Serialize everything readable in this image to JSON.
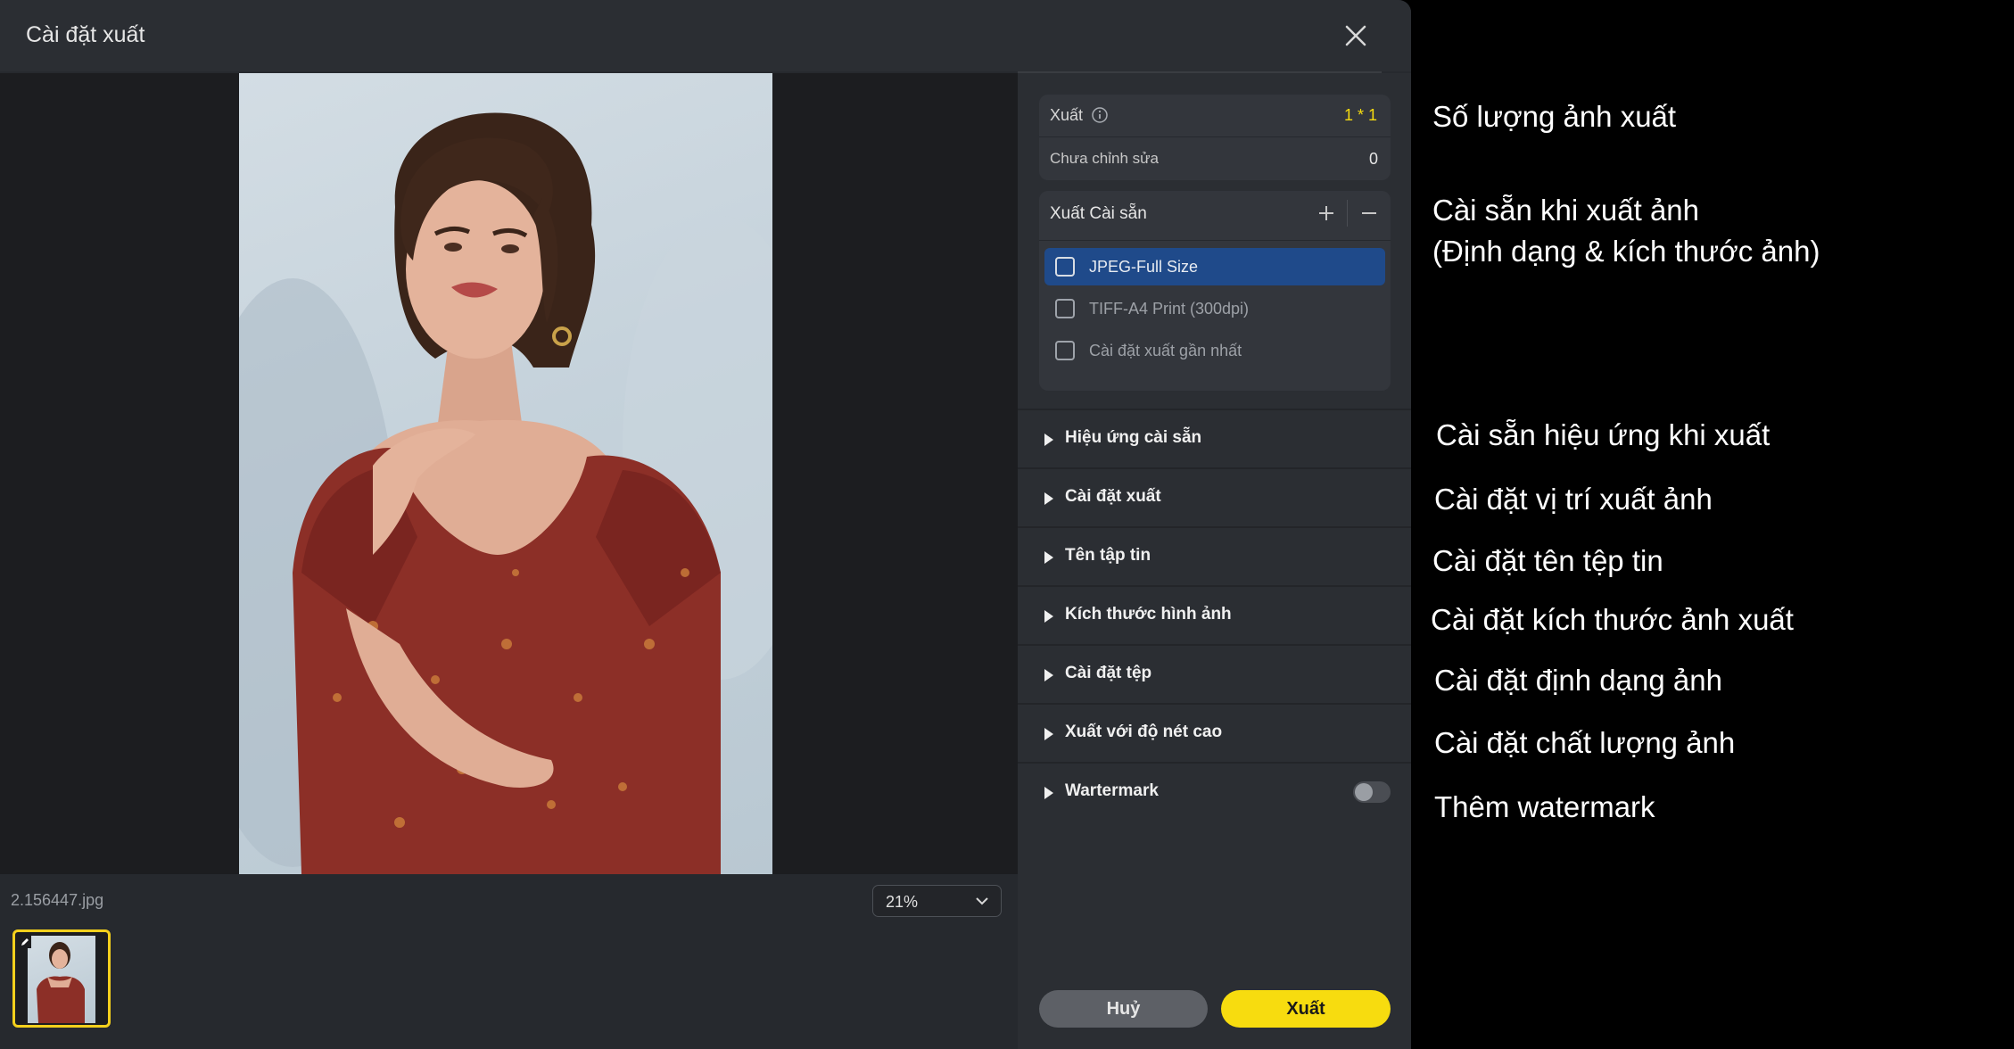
{
  "dialog": {
    "title": "Cài đặt xuất",
    "close_icon": "close-icon"
  },
  "preview": {
    "filename": "2.156447.jpg",
    "zoom": "21%",
    "zoom_icon": "chevron-down-icon"
  },
  "summary": {
    "export_label": "Xuất",
    "export_value": "1 * 1",
    "unedited_label": "Chưa chỉnh sửa",
    "unedited_value": "0",
    "value_color": "#f7dc0f"
  },
  "presets": {
    "header": "Xuất Cài sẵn",
    "add_icon": "plus-icon",
    "remove_icon": "minus-icon",
    "items": [
      {
        "label": "JPEG-Full Size",
        "selected": true
      },
      {
        "label": "TIFF-A4 Print (300dpi)",
        "selected": false
      },
      {
        "label": "Cài đặt xuất gần nhất",
        "selected": false
      }
    ]
  },
  "sections": [
    {
      "label": "Hiệu ứng cài sẵn"
    },
    {
      "label": "Cài đặt xuất"
    },
    {
      "label": "Tên tập tin"
    },
    {
      "label": "Kích thước hình ảnh"
    },
    {
      "label": "Cài đặt tệp"
    },
    {
      "label": "Xuất với độ nét cao"
    },
    {
      "label": "Wartermark",
      "toggle_on": false
    }
  ],
  "buttons": {
    "cancel": "Huỷ",
    "export": "Xuất"
  },
  "annotations": {
    "a1": "Số lượng ảnh xuất",
    "a2_line1": "Cài sẵn khi xuất ảnh",
    "a2_line2": "(Định dạng & kích thước ảnh)",
    "a3": "Cài sẵn hiệu ứng khi xuất",
    "a4": "Cài đặt vị trí xuất ảnh",
    "a5": "Cài đặt tên tệp tin",
    "a6": "Cài đặt kích thước ảnh xuất",
    "a7": "Cài đặt định dạng ảnh",
    "a8": "Cài đặt chất lượng ảnh",
    "a9": "Thêm watermark"
  },
  "colors": {
    "accent_yellow": "#f7dc0f",
    "selection_blue": "#1f4a8a",
    "panel_bg": "#2b2e33"
  }
}
